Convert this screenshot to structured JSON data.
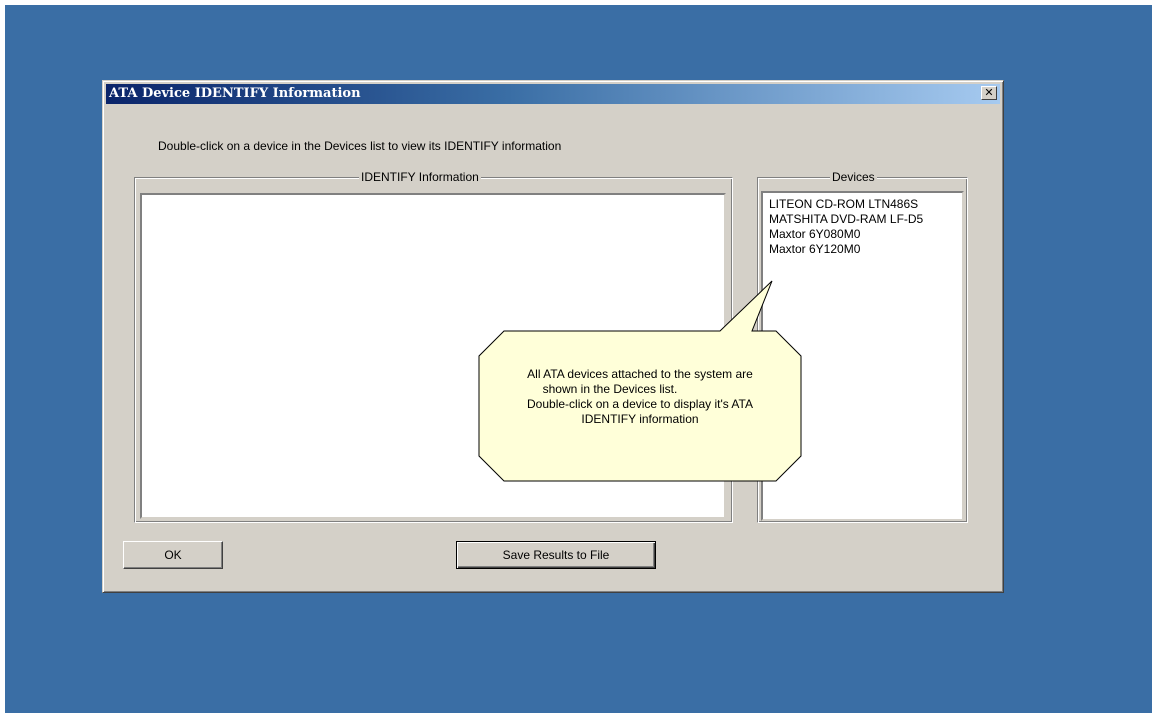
{
  "window": {
    "title": "ATA Device IDENTIFY Information",
    "close_glyph": "✕"
  },
  "instruction": "Double-click on a device in the Devices list to view its IDENTIFY information",
  "identify_group": {
    "label": "IDENTIFY Information",
    "content": ""
  },
  "devices_group": {
    "label": "Devices",
    "items": [
      "LITEON CD-ROM LTN486S",
      "MATSHITA DVD-RAM LF-D5",
      "Maxtor 6Y080M0",
      "Maxtor 6Y120M0"
    ]
  },
  "balloon": {
    "lines": [
      "All ATA devices attached to the system are",
      "shown in the Devices list.",
      "Double-click on a device to display it's ATA",
      "IDENTIFY information"
    ],
    "fill": "#ffffd9"
  },
  "buttons": {
    "ok_label": "OK",
    "save_label": "Save Results to File"
  },
  "colors": {
    "desktop": "#3a6ea5",
    "window_face": "#d4d0c8",
    "title_start": "#0a246a",
    "title_end": "#a6caf0"
  }
}
